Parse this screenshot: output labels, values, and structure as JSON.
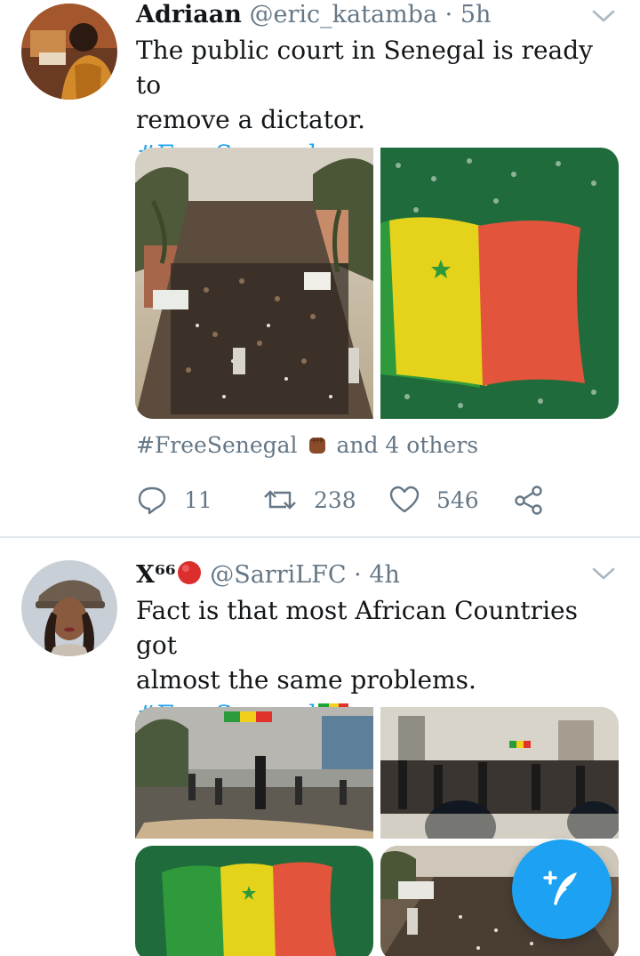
{
  "tweets": [
    {
      "name": "Adriaan",
      "handle": "@eric_katamba",
      "separator": "·",
      "time": "5h",
      "text_lines": [
        "The public court in Senegal is ready to",
        "remove a dictator."
      ],
      "hashtag": "#FreeSenegal",
      "meta_hashtag": "#FreeSenegal",
      "meta_others": "and 4 others",
      "replies": "11",
      "retweets": "238",
      "likes": "546"
    },
    {
      "name": "X⁶⁶",
      "handle": "@SarriLFC",
      "separator": "·",
      "time": "4h",
      "text_lines": [
        "Fact is that most African Countries got",
        "almost the same problems."
      ],
      "hashtag": "#FreeSenegal"
    }
  ],
  "icons": [
    "chevron-down-icon",
    "reply-icon",
    "retweet-icon",
    "like-icon",
    "share-icon",
    "compose-tweet-icon",
    "senegal-flag-icon",
    "raised-fist-icon",
    "red-circle-icon"
  ],
  "colors": {
    "accent": "#1da1f2",
    "text": "#14171a",
    "muted": "#657786",
    "divider": "#e1e8ed"
  }
}
